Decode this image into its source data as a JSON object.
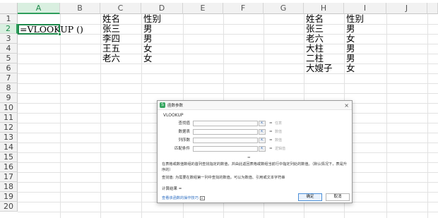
{
  "columns": [
    "A",
    "B",
    "C",
    "D",
    "E",
    "F",
    "G",
    "H",
    "I",
    "J"
  ],
  "selected_column": "A",
  "rows": [
    "1",
    "2",
    "3",
    "4",
    "5",
    "6",
    "7",
    "8",
    "9",
    "10",
    "11",
    "12",
    "13",
    "14",
    "15",
    "16",
    "17",
    "18",
    "19",
    "20"
  ],
  "selected_row": "2",
  "cells": {
    "A2": "=VLOOKUP ()",
    "C1": "姓名",
    "D1": "性别",
    "C2": "张三",
    "D2": "男",
    "C3": "李四",
    "D3": "男",
    "C4": "王五",
    "D4": "女",
    "C5": "老六",
    "D5": "女",
    "H1": "姓名",
    "I1": "性别",
    "H2": "张三",
    "I2": "男",
    "H3": "老六",
    "I3": "女",
    "H4": "大柱",
    "I4": "男",
    "H5": "二柱",
    "I5": "男",
    "H6": "大嫂子",
    "I6": "女"
  },
  "dialog": {
    "title": "函数参数",
    "close_glyph": "×",
    "function_name": "VLOOKUP",
    "args": [
      {
        "label": "查找值",
        "hint": "任意"
      },
      {
        "label": "数据表",
        "hint": "数值"
      },
      {
        "label": "列序数",
        "hint": "数值"
      },
      {
        "label": "匹配条件",
        "hint": "逻辑值"
      }
    ],
    "equals": "=",
    "description": "在表格或数值数组的首列查找指定的数值，并由此返回表格或数组当前行中指定列处的数值。（默认情况下，表是升序的）",
    "param_description": "查找值:    为需要在数组第一列中查找的数值。可以为数值、引用或文本字符串",
    "result_label": "计算结果 =",
    "help_link": "查看该函数的操作技巧",
    "ok_label": "确定",
    "cancel_label": "取消"
  }
}
